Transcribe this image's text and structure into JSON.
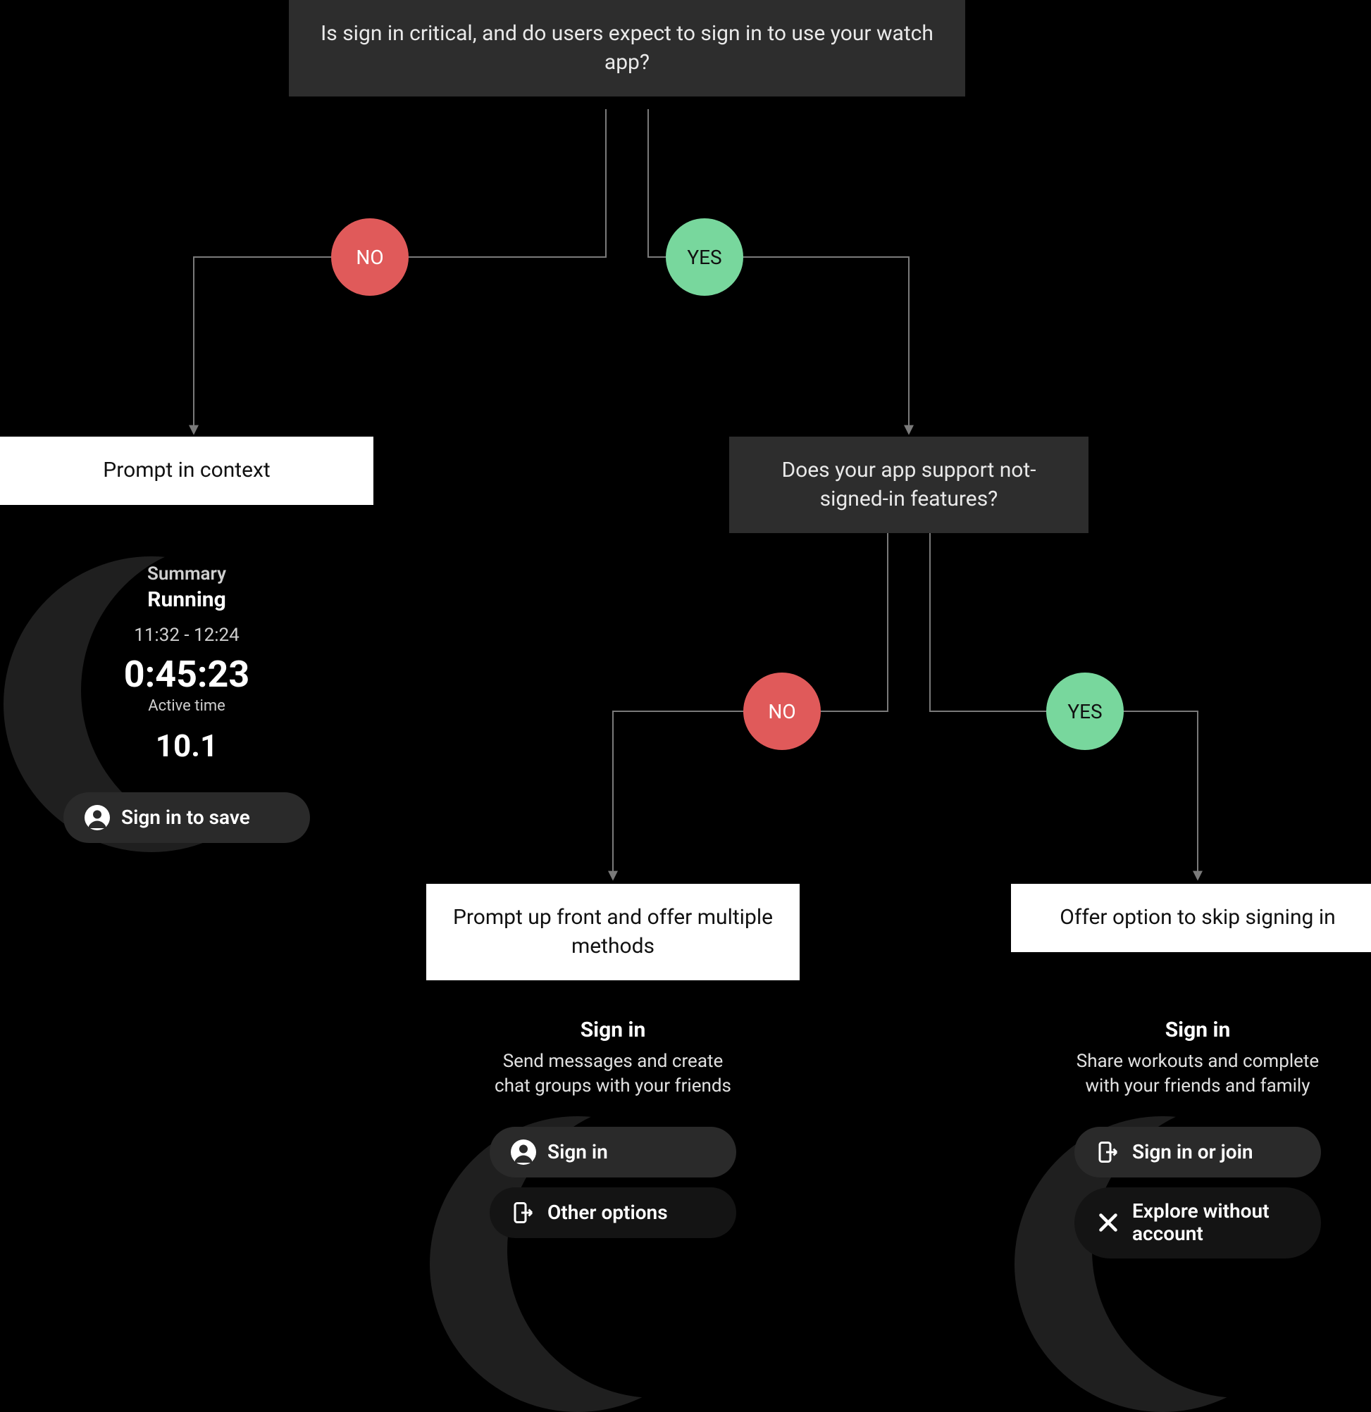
{
  "q1": "Is sign in critical, and do users expect to sign in to use your watch app?",
  "q2": "Does your app support not-signed-in features?",
  "no": "NO",
  "yes": "YES",
  "leaf_context": "Prompt in context",
  "leaf_upfront": "Prompt up front and offer multiple methods",
  "leaf_skip": "Offer option to skip signing in",
  "watch_context": {
    "summary": "Summary",
    "activity": "Running",
    "range": "11:32 - 12:24",
    "duration": "0:45:23",
    "duration_label": "Active time",
    "distance": "10.1",
    "chip": "Sign in to save"
  },
  "watch_upfront": {
    "title": "Sign in",
    "desc": "Send messages and create chat groups with your friends",
    "chip1": "Sign in",
    "chip2": "Other options"
  },
  "watch_skip": {
    "title": "Sign in",
    "desc": "Share workouts and complete with your friends and family",
    "chip1": "Sign in or join",
    "chip2": "Explore without account"
  }
}
